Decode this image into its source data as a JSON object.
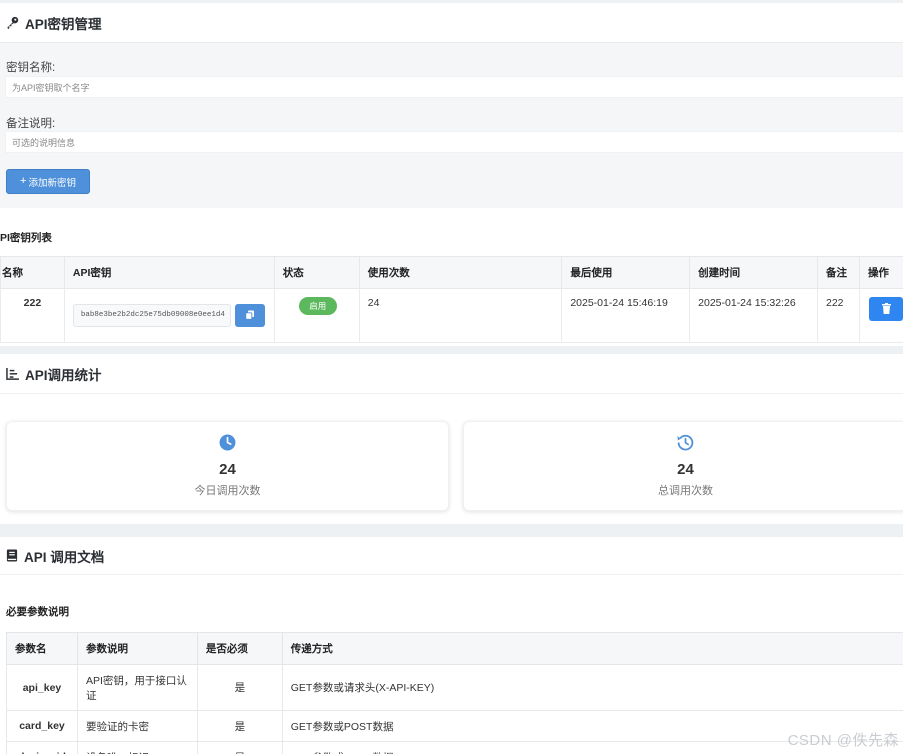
{
  "key_manager": {
    "title": "API密钥管理",
    "name_label": "密钥名称:",
    "name_placeholder": "为API密钥取个名字",
    "note_label": "备注说明:",
    "note_placeholder": "可选的说明信息",
    "add_button": "添加新密钥",
    "icon": "key-icon"
  },
  "key_list": {
    "title": "PI密钥列表",
    "columns": [
      "名称",
      "API密钥",
      "状态",
      "使用次数",
      "最后使用",
      "创建时间",
      "备注",
      "操作"
    ],
    "rows": [
      {
        "name": "222",
        "key": "bab8e3be2b2dc25e75db09008e0ee1d4",
        "status": "启用",
        "uses": "24",
        "last_used": "2025-01-24 15:46:19",
        "created": "2025-01-24 15:32:26",
        "note": "222"
      }
    ]
  },
  "stats": {
    "title": "API调用统计",
    "icon": "chart-icon",
    "today": {
      "value": "24",
      "label": "今日调用次数",
      "icon": "clock-icon"
    },
    "total": {
      "value": "24",
      "label": "总调用次数",
      "icon": "history-icon"
    }
  },
  "docs": {
    "title": "API 调用文档",
    "icon": "book-icon",
    "params_title": "必要参数说明",
    "columns": [
      "参数名",
      "参数说明",
      "是否必须",
      "传递方式"
    ],
    "rows": [
      {
        "name": "api_key",
        "desc": "API密钥，用于接口认证",
        "required": "是",
        "method": "GET参数或请求头(X-API-KEY)"
      },
      {
        "name": "card_key",
        "desc": "要验证的卡密",
        "required": "是",
        "method": "GET参数或POST数据"
      },
      {
        "name": "device_id",
        "desc": "设备唯一标识",
        "required": "是",
        "method": "GET参数或POST数据"
      }
    ]
  },
  "colors": {
    "primary": "#4e90d9",
    "success": "#5cb85c",
    "danger_btn": "#2f86f0"
  },
  "watermark": "CSDN @佚先森"
}
